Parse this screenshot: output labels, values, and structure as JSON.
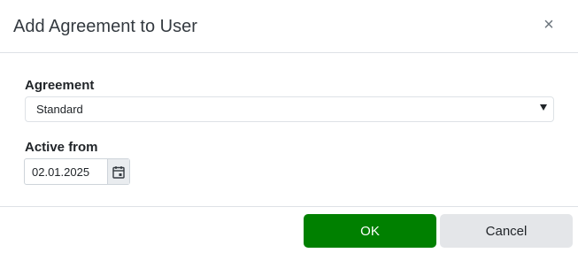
{
  "dialog": {
    "title": "Add Agreement to User",
    "close_icon": "close-icon",
    "close_glyph": "×"
  },
  "form": {
    "agreement": {
      "label": "Agreement",
      "selected_value": "Standard",
      "arrow_icon": "dropdown-arrow-icon"
    },
    "active_from": {
      "label": "Active from",
      "value": "02.01.2025",
      "calendar_icon": "calendar-icon"
    }
  },
  "footer": {
    "ok_label": "OK",
    "cancel_label": "Cancel"
  },
  "colors": {
    "ok_button": "#008000",
    "cancel_button": "#e4e6e9",
    "calendar_button": "#e9ecef"
  }
}
